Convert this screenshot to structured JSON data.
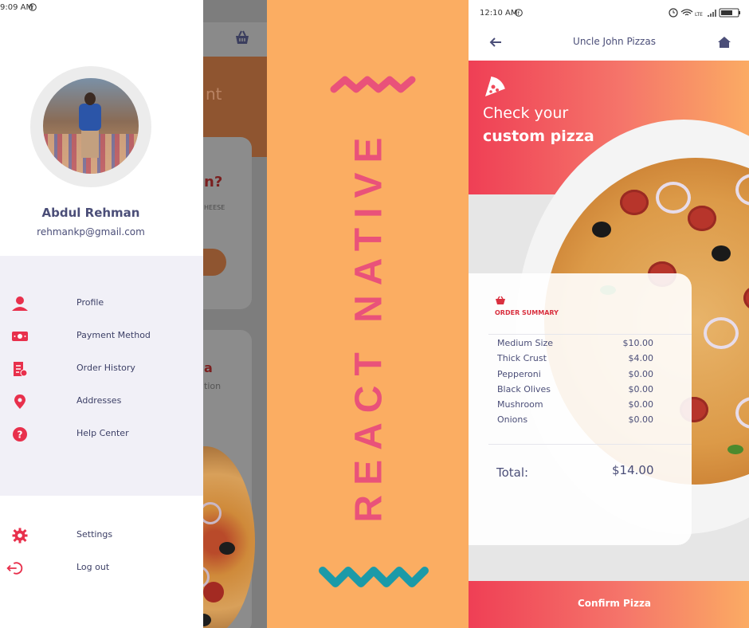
{
  "left_screen": {
    "status_time": "9:09 AM",
    "user": {
      "name": "Abdul Rehman",
      "email": "rehmankp@gmail.com"
    },
    "menu": [
      {
        "label": "Profile",
        "icon": "user-icon"
      },
      {
        "label": "Payment Method",
        "icon": "payment-card-icon"
      },
      {
        "label": "Order History",
        "icon": "receipt-icon"
      },
      {
        "label": "Addresses",
        "icon": "location-pin-icon"
      },
      {
        "label": "Help Center",
        "icon": "help-icon"
      }
    ],
    "bottom_menu": [
      {
        "label": "Settings",
        "icon": "gear-icon"
      },
      {
        "label": "Log out",
        "icon": "logout-icon"
      }
    ],
    "background_fragments": {
      "hero": "nt",
      "question": "n?",
      "cheese": "HEESE",
      "title": "a",
      "subtitle": "tion"
    },
    "accent": "#e8304c"
  },
  "middle": {
    "title": "REACT NATIVE",
    "background": "#fbad62",
    "text_color": "#e9527a",
    "zigzag_top_color": "#e9527a",
    "zigzag_bottom_color": "#1b9aa8"
  },
  "right_screen": {
    "status_time": "12:10 AM",
    "nav_title": "Uncle John Pizzas",
    "hero_line1": "Check your",
    "hero_line2": "custom pizza",
    "order_summary_title": "ORDER SUMMARY",
    "items": [
      {
        "name": "Medium Size",
        "price": "$10.00"
      },
      {
        "name": "Thick Crust",
        "price": "$4.00"
      },
      {
        "name": "Pepperoni",
        "price": "$0.00"
      },
      {
        "name": "Black Olives",
        "price": "$0.00"
      },
      {
        "name": "Mushroom",
        "price": "$0.00"
      },
      {
        "name": "Onions",
        "price": "$0.00"
      }
    ],
    "total_label": "Total:",
    "total_value": "$14.00",
    "confirm_label": "Confirm Pizza"
  }
}
